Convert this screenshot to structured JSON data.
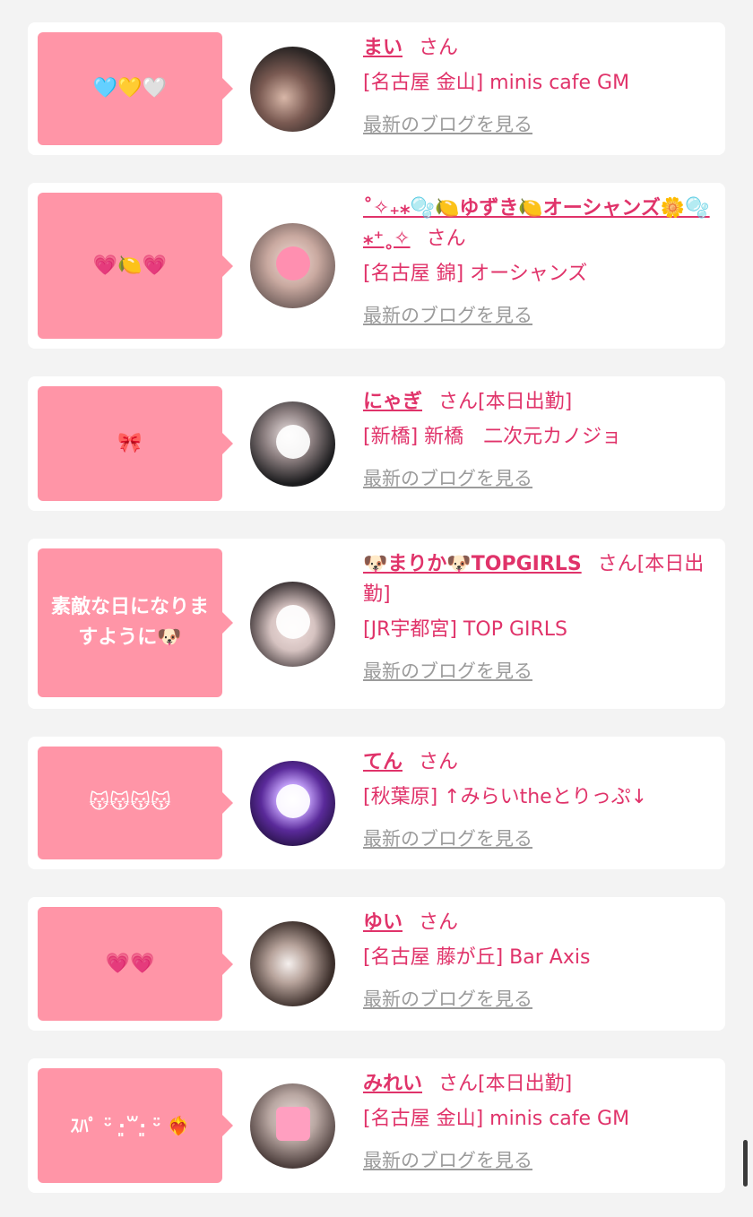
{
  "cards": [
    {
      "message": "🩵💛🤍",
      "name": "まい",
      "honorific": "さん",
      "tag": "",
      "shop": "[名古屋 金山] minis cafe GM",
      "blog_link": "最新のブログを見る"
    },
    {
      "message": "💗🍋💗",
      "name": "˚✧₊⁎🫧🍋ゆずき🍋オーシャンズ🌼🫧⁎⁺˳✧",
      "honorific": "さん",
      "tag": "",
      "shop": "[名古屋 錦] オーシャンズ",
      "blog_link": "最新のブログを見る"
    },
    {
      "message": "🎀",
      "name": "にゃぎ",
      "honorific": "さん",
      "tag": "[本日出勤]",
      "shop": "[新橋] 新橋　二次元カノジョ",
      "blog_link": "最新のブログを見る"
    },
    {
      "message": "素敵な日になりますように🐶",
      "name": "🐶まりか🐶TOPGIRLS",
      "honorific": "さん",
      "tag": "[本日出勤]",
      "shop": "[JR宇都宮] TOP GIRLS",
      "blog_link": "最新のブログを見る"
    },
    {
      "message": "😽😽😽😽",
      "name": "てん",
      "honorific": "さん",
      "tag": "",
      "shop": "[秋葉原] ↑みらいtheとりっぷ↓",
      "blog_link": "最新のブログを見る"
    },
    {
      "message": "💗💗",
      "name": "ゆい",
      "honorific": "さん",
      "tag": "",
      "shop": "[名古屋 藤が丘] Bar Axis",
      "blog_link": "最新のブログを見る"
    },
    {
      "message": "ｽﾊﾟ ᵕ̈ ·͈꒳·͈ ᵕ̈ ❤️‍🔥",
      "name": "みれい",
      "honorific": "さん",
      "tag": "[本日出勤]",
      "shop": "[名古屋 金山] minis cafe GM",
      "blog_link": "最新のブログを見る"
    }
  ],
  "colors": {
    "accent": "#e0336a",
    "bubble": "#ff95a7",
    "link_gray": "#9b9b9b"
  }
}
